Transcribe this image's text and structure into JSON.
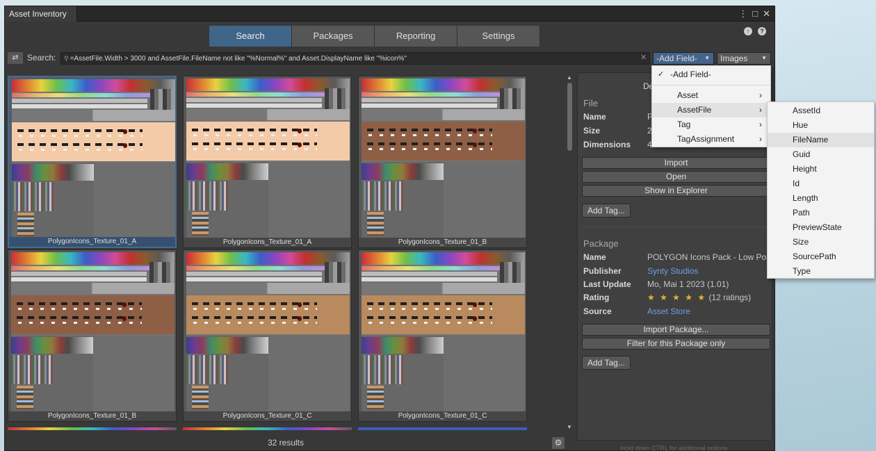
{
  "window": {
    "title": "Asset Inventory"
  },
  "nav": {
    "tabs": [
      "Search",
      "Packages",
      "Reporting",
      "Settings"
    ],
    "active": "Search"
  },
  "search": {
    "label": "Search:",
    "query": "=AssetFile.Width > 3000 and AssetFile.FileName not like \"%Normal%\" and Asset.DisplayName like \"%icon%\"",
    "add_field": "-Add Field-",
    "type_filter": "Images"
  },
  "grid": {
    "tiles": [
      {
        "label": "PolygonIcons_Texture_01_A",
        "skin": "#f4cba9",
        "selected": true
      },
      {
        "label": "PolygonIcons_Texture_01_A",
        "skin": "#f4cba9",
        "selected": false
      },
      {
        "label": "PolygonIcons_Texture_01_B",
        "skin": "#8e5f45",
        "selected": false
      },
      {
        "label": "PolygonIcons_Texture_01_B",
        "skin": "#8e5f45",
        "selected": false
      },
      {
        "label": "PolygonIcons_Texture_01_C",
        "skin": "#b98a5e",
        "selected": false
      },
      {
        "label": "PolygonIcons_Texture_01_C",
        "skin": "#b98a5e",
        "selected": false
      }
    ],
    "results": "32 results"
  },
  "details": {
    "title_partial": "De",
    "file": {
      "heading": "File",
      "rows": [
        {
          "key": "Name",
          "value": "P"
        },
        {
          "key": "Size",
          "value": "2"
        },
        {
          "key": "Dimensions",
          "value": "4"
        }
      ],
      "buttons": [
        "Import",
        "Open",
        "Show in Explorer"
      ],
      "add_tag": "Add Tag..."
    },
    "package": {
      "heading": "Package",
      "name_key": "Name",
      "name_value": "POLYGON Icons Pack - Low Pol",
      "publisher_key": "Publisher",
      "publisher_value": "Synty Studios",
      "update_key": "Last Update",
      "update_value": "Mo, Mai 1 2023 (1.01)",
      "rating_key": "Rating",
      "rating_stars": "★ ★ ★ ★ ★",
      "rating_count": "(12 ratings)",
      "source_key": "Source",
      "source_value": "Asset Store",
      "buttons": [
        "Import Package...",
        "Filter for this Package only"
      ],
      "add_tag": "Add Tag..."
    },
    "hint": "Hold down CTRL for additional options."
  },
  "menus": {
    "main": {
      "checked": "-Add Field-",
      "items": [
        "Asset",
        "AssetFile",
        "Tag",
        "TagAssignment"
      ]
    },
    "sub": [
      "AssetId",
      "Hue",
      "FileName",
      "Guid",
      "Height",
      "Id",
      "Length",
      "Path",
      "PreviewState",
      "Size",
      "SourcePath",
      "Type"
    ],
    "sub_highlight": "FileName"
  },
  "colors": {
    "accent": "#3f6589",
    "link": "#6f9fe6",
    "star": "#e7b42e"
  }
}
